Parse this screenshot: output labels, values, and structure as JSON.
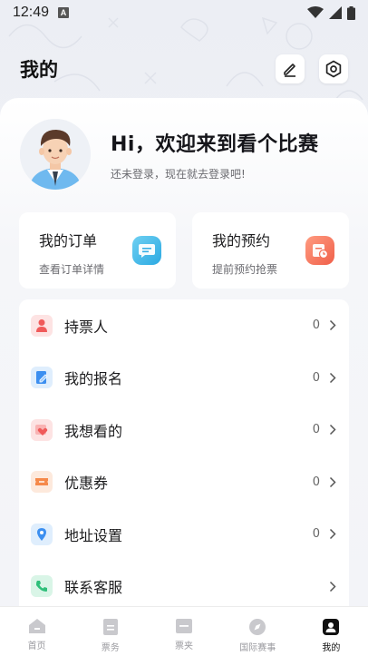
{
  "status_bar": {
    "time": "12:49",
    "notif_letter": "A"
  },
  "header": {
    "title": "我的"
  },
  "profile": {
    "greeting": "Hi，欢迎来到看个比赛",
    "login_hint": "还未登录，现在就去登录吧!"
  },
  "cards": [
    {
      "title": "我的订单",
      "subtitle": "查看订单详情",
      "icon": "order-icon",
      "color": "#3fb8e8"
    },
    {
      "title": "我的预约",
      "subtitle": "提前预约抢票",
      "icon": "reservation-icon",
      "color": "#f57a5e"
    }
  ],
  "menu": [
    {
      "label": "持票人",
      "count": "0",
      "icon": "ticket-holder-icon",
      "color": "#f05a5a"
    },
    {
      "label": "我的报名",
      "count": "0",
      "icon": "registration-icon",
      "color": "#3c8ff0"
    },
    {
      "label": "我想看的",
      "count": "0",
      "icon": "heart-icon",
      "color": "#f05a5a"
    },
    {
      "label": "优惠券",
      "count": "0",
      "icon": "coupon-icon",
      "color": "#f5894a"
    },
    {
      "label": "地址设置",
      "count": "0",
      "icon": "location-icon",
      "color": "#3c8ff0"
    },
    {
      "label": "联系客服",
      "count": "",
      "icon": "phone-icon",
      "color": "#2fbf7a"
    }
  ],
  "tabs": [
    {
      "label": "首页",
      "icon": "home-icon"
    },
    {
      "label": "票务",
      "icon": "ticket-icon"
    },
    {
      "label": "票夹",
      "icon": "ticket-folder-icon"
    },
    {
      "label": "国际赛事",
      "icon": "compass-icon"
    },
    {
      "label": "我的",
      "icon": "profile-icon",
      "active": true
    }
  ]
}
